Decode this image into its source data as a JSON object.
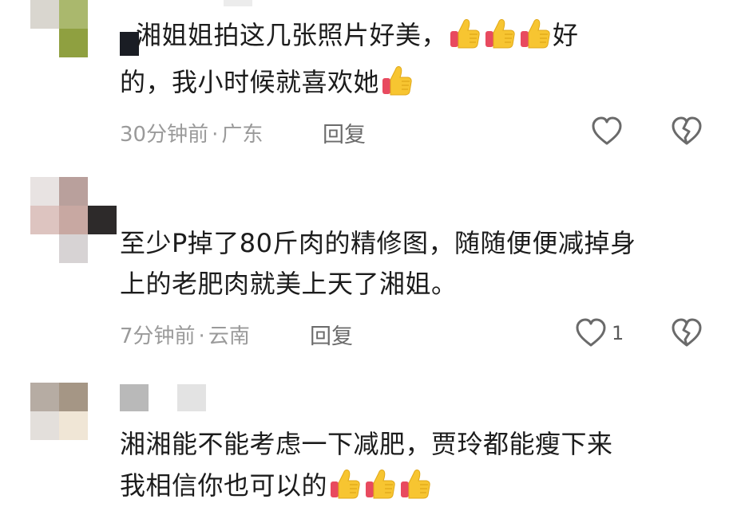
{
  "comments": [
    {
      "text": "湘姐姐拍这几张照片好美，",
      "text_2": "好",
      "text_3": "的，我小时候就喜欢她",
      "time": "30分钟前",
      "location": "广东",
      "reply_label": "回复",
      "likes": ""
    },
    {
      "text": "至少P掉了80斤肉的精修图，随随便便减掉身",
      "text_2": "上的老肥肉就美上天了湘姐。",
      "time": "7分钟前",
      "location": "云南",
      "reply_label": "回复",
      "likes": "1"
    },
    {
      "text": "湘湘能不能考虑一下减肥，贾玲都能瘦下来",
      "text_2": "我相信你也可以的"
    }
  ],
  "meta_separator": "·",
  "icons": {
    "like": "heart-outline-icon",
    "dislike": "broken-heart-icon",
    "emoji": "thumbs-up-emoji"
  },
  "colors": {
    "text": "#1c1c1c",
    "meta": "#9a9a9a",
    "icon": "#6a6a6a",
    "thumb": "#f7c531"
  }
}
